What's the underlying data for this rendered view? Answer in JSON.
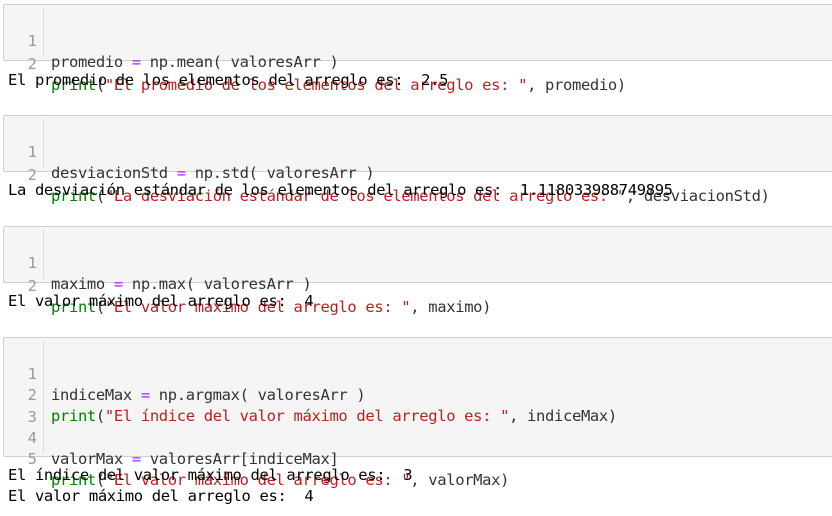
{
  "cells": [
    {
      "lines": [
        {
          "n": "1",
          "t": [
            {
              "c": "",
              "v": "promedio "
            },
            {
              "c": "op",
              "v": "="
            },
            {
              "c": "",
              "v": " np.mean( valoresArr )"
            }
          ]
        },
        {
          "n": "2",
          "t": [
            {
              "c": "kw",
              "v": "print"
            },
            {
              "c": "",
              "v": "("
            },
            {
              "c": "str",
              "v": "\"El promedio de los elementos del arreglo es: \""
            },
            {
              "c": "",
              "v": ", promedio)"
            }
          ]
        }
      ],
      "output": [
        "El promedio de los elementos del arreglo es:  2.5"
      ]
    },
    {
      "lines": [
        {
          "n": "1",
          "t": [
            {
              "c": "",
              "v": "desviacionStd "
            },
            {
              "c": "op",
              "v": "="
            },
            {
              "c": "",
              "v": " np.std( valoresArr )"
            }
          ]
        },
        {
          "n": "2",
          "t": [
            {
              "c": "kw",
              "v": "print"
            },
            {
              "c": "",
              "v": "("
            },
            {
              "c": "str",
              "v": "\"La desviación estándar de los elementos del arreglo es: \""
            },
            {
              "c": "",
              "v": ", desviacionStd)"
            }
          ]
        }
      ],
      "output": [
        "La desviación estándar de los elementos del arreglo es:  1.118033988749895"
      ]
    },
    {
      "lines": [
        {
          "n": "1",
          "t": [
            {
              "c": "",
              "v": "maximo "
            },
            {
              "c": "op",
              "v": "="
            },
            {
              "c": "",
              "v": " np.max( valoresArr )"
            }
          ]
        },
        {
          "n": "2",
          "t": [
            {
              "c": "kw",
              "v": "print"
            },
            {
              "c": "",
              "v": "("
            },
            {
              "c": "str",
              "v": "\"El valor máximo del arreglo es: \""
            },
            {
              "c": "",
              "v": ", maximo)"
            }
          ]
        }
      ],
      "output": [
        "El valor máximo del arreglo es:  4"
      ]
    },
    {
      "lines": [
        {
          "n": "1",
          "t": [
            {
              "c": "",
              "v": "indiceMax "
            },
            {
              "c": "op",
              "v": "="
            },
            {
              "c": "",
              "v": " np.argmax( valoresArr )"
            }
          ]
        },
        {
          "n": "2",
          "t": [
            {
              "c": "kw",
              "v": "print"
            },
            {
              "c": "",
              "v": "("
            },
            {
              "c": "str",
              "v": "\"El índice del valor máximo del arreglo es: \""
            },
            {
              "c": "",
              "v": ", indiceMax)"
            }
          ]
        },
        {
          "n": "3",
          "t": []
        },
        {
          "n": "4",
          "t": [
            {
              "c": "",
              "v": "valorMax "
            },
            {
              "c": "op",
              "v": "="
            },
            {
              "c": "",
              "v": " valoresArr[indiceMax]"
            }
          ]
        },
        {
          "n": "5",
          "t": [
            {
              "c": "kw",
              "v": "print"
            },
            {
              "c": "",
              "v": "("
            },
            {
              "c": "str",
              "v": "\"El valor máximo del arreglo es: \""
            },
            {
              "c": "",
              "v": ", valorMax)"
            }
          ]
        }
      ],
      "output": [
        "El índice del valor máximo del arreglo es:  3",
        "El valor máximo del arreglo es:  4"
      ]
    }
  ],
  "colors": {
    "cell_bg": "#f5f5f5",
    "keyword": "#008000",
    "operator": "#aa22ff",
    "string": "#ba2121",
    "line_number": "#999999"
  }
}
